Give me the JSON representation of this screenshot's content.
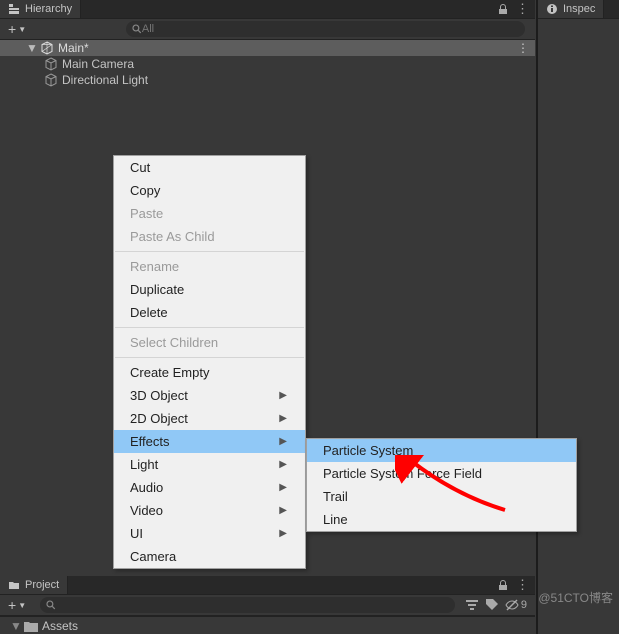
{
  "hierarchy_panel": {
    "tab_title": "Hierarchy",
    "search_placeholder": "All",
    "add_label": "+",
    "scene": {
      "name": "Main*",
      "children": [
        {
          "name": "Main Camera"
        },
        {
          "name": "Directional Light"
        }
      ]
    }
  },
  "context_menu": {
    "items": [
      {
        "label": "Cut",
        "disabled": false
      },
      {
        "label": "Copy",
        "disabled": false
      },
      {
        "label": "Paste",
        "disabled": true
      },
      {
        "label": "Paste As Child",
        "disabled": true
      },
      {
        "sep": true
      },
      {
        "label": "Rename",
        "disabled": true
      },
      {
        "label": "Duplicate",
        "disabled": false
      },
      {
        "label": "Delete",
        "disabled": false
      },
      {
        "sep": true
      },
      {
        "label": "Select Children",
        "disabled": true
      },
      {
        "sep": true
      },
      {
        "label": "Create Empty",
        "disabled": false
      },
      {
        "label": "3D Object",
        "submenu": true
      },
      {
        "label": "2D Object",
        "submenu": true
      },
      {
        "label": "Effects",
        "submenu": true,
        "highlight": true
      },
      {
        "label": "Light",
        "submenu": true
      },
      {
        "label": "Audio",
        "submenu": true
      },
      {
        "label": "Video",
        "submenu": true
      },
      {
        "label": "UI",
        "submenu": true
      },
      {
        "label": "Camera",
        "disabled": false
      }
    ],
    "submenu": {
      "parent": "Effects",
      "items": [
        {
          "label": "Particle System",
          "highlight": true
        },
        {
          "label": "Particle System Force Field"
        },
        {
          "label": "Trail"
        },
        {
          "label": "Line"
        }
      ]
    }
  },
  "project_panel": {
    "tab_title": "Project",
    "add_label": "+",
    "hidden_count": "9",
    "root": "Assets"
  },
  "inspector_panel": {
    "tab_title": "Inspec"
  },
  "watermark": "@51CTO博客"
}
